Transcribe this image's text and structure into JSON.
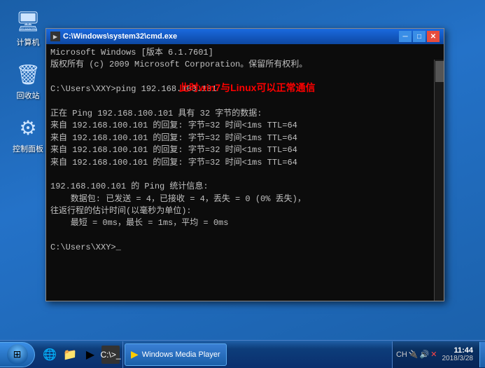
{
  "desktop": {
    "icons": [
      {
        "id": "computer",
        "label": "计算机",
        "unicode": "🖥"
      },
      {
        "id": "recycle",
        "label": "回收站",
        "unicode": "🗑"
      },
      {
        "id": "control",
        "label": "控制面板",
        "unicode": "🔧"
      }
    ]
  },
  "cmd": {
    "title": "C:\\Windows\\system32\\cmd.exe",
    "highlight_text": "此时win7与Linux可以正常通信",
    "content_lines": [
      "Microsoft Windows [版本 6.1.7601]",
      "版权所有 (c) 2009 Microsoft Corporation。保留所有权利。",
      "",
      "C:\\Users\\XXY>ping 192.168.100.101",
      "",
      "正在 Ping 192.168.100.101 具有 32 字节的数据:",
      "来自 192.168.100.101 的回复: 字节=32 时间<1ms TTL=64",
      "来自 192.168.100.101 的回复: 字节=32 时间<1ms TTL=64",
      "来自 192.168.100.101 的回复: 字节=32 时间<1ms TTL=64",
      "来自 192.168.100.101 的回复: 字节=32 时间<1ms TTL=64",
      "",
      "192.168.100.101 的 Ping 统计信息:",
      "    数据包: 已发送 = 4，已接收 = 4，丢失 = 0 (0% 丢失)，",
      "往返行程的估计时间(以毫秒为单位):",
      "    最短 = 0ms，最长 = 1ms，平均 = 0ms",
      "",
      "C:\\Users\\XXY>_"
    ],
    "buttons": {
      "minimize": "─",
      "maximize": "□",
      "close": "✕"
    }
  },
  "taskbar": {
    "task_label": "Windows Media Player",
    "clock": {
      "time": "11:44",
      "date": "2018/3/28"
    },
    "tray": {
      "icons": [
        "CH",
        "⊕",
        "?"
      ]
    }
  }
}
